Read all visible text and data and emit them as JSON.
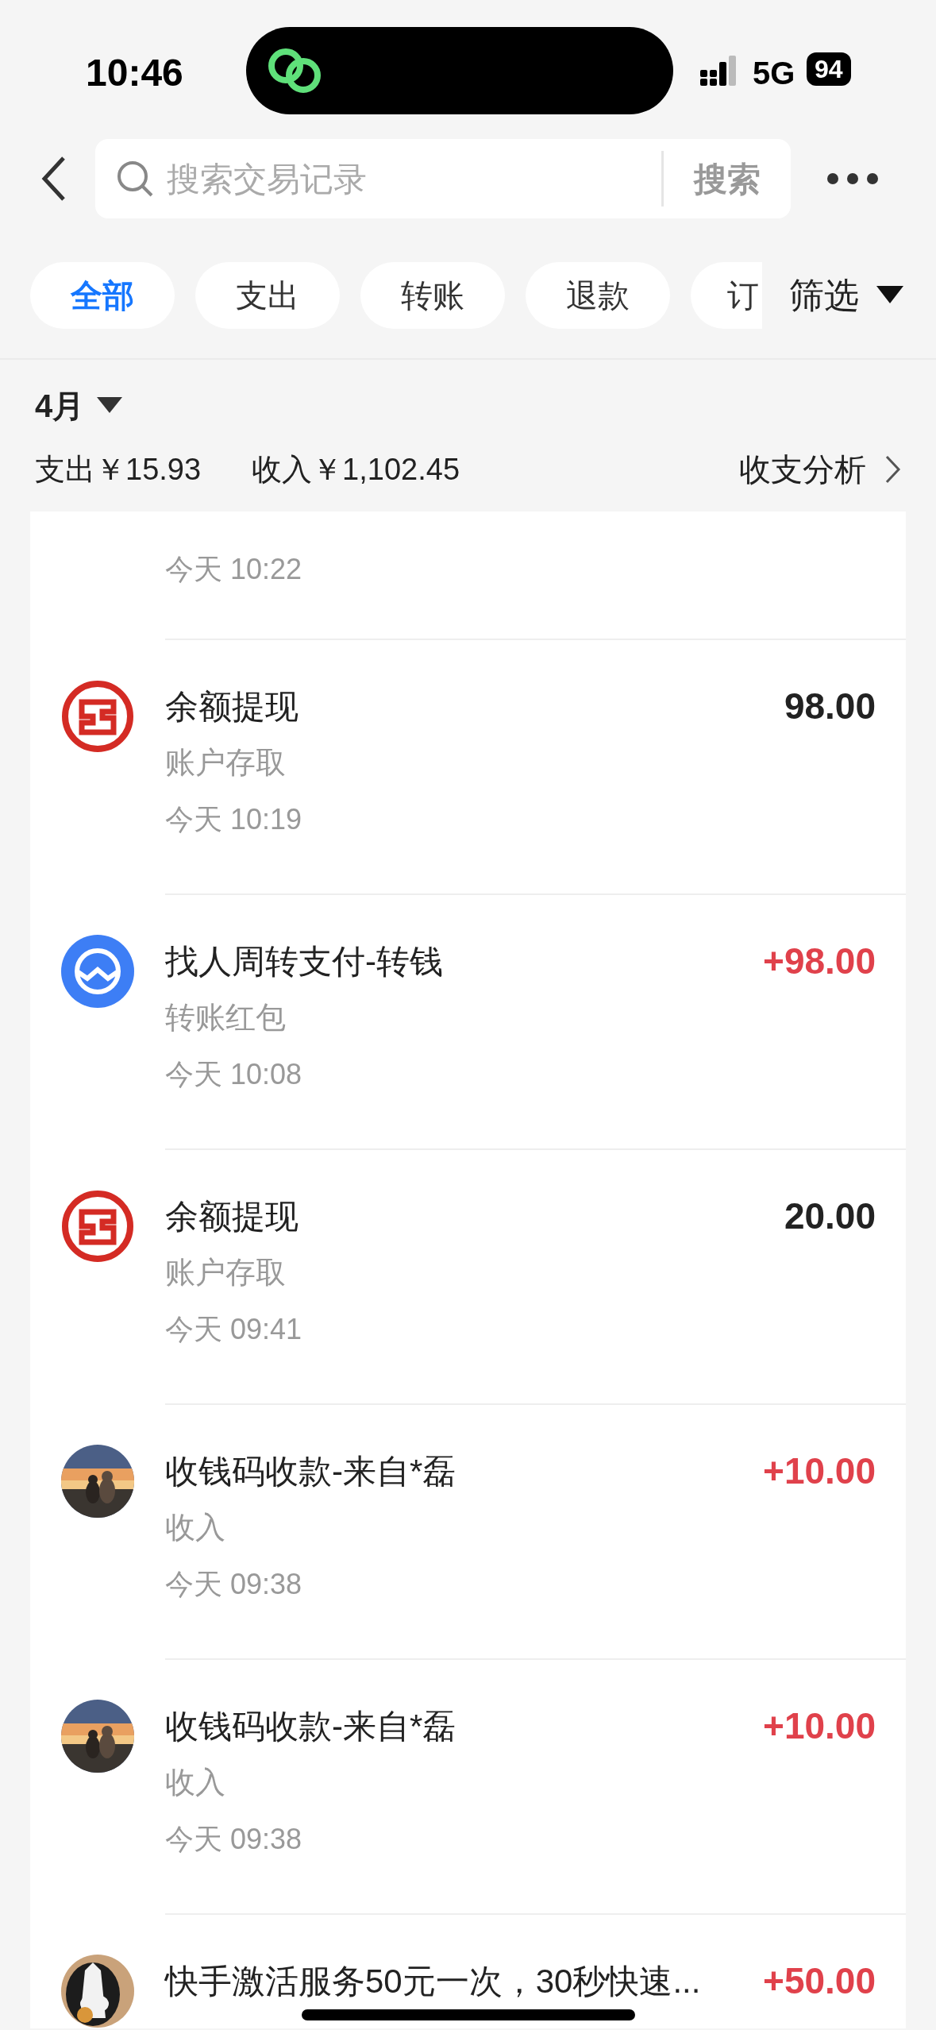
{
  "status_bar": {
    "time": "10:46",
    "network": "5G",
    "battery": "94"
  },
  "search": {
    "placeholder": "搜索交易记录",
    "button": "搜索"
  },
  "tabs": [
    {
      "label": "全部",
      "selected": true
    },
    {
      "label": "支出",
      "selected": false
    },
    {
      "label": "转账",
      "selected": false
    },
    {
      "label": "退款",
      "selected": false
    },
    {
      "label": "订",
      "selected": false
    }
  ],
  "filter": "筛选",
  "summary": {
    "month": "4月",
    "expense": "支出￥15.93",
    "income": "收入￥1,102.45",
    "analysis": "收支分析"
  },
  "partial_row_time": "今天 10:22",
  "transactions": [
    {
      "kind": "bank",
      "title": "余额提现",
      "amount": "98.00",
      "income": false,
      "category": "账户存取",
      "time": "今天 10:19"
    },
    {
      "kind": "transfer",
      "title": "找人周转支付-转钱",
      "amount": "+98.00",
      "income": true,
      "category": "转账红包",
      "time": "今天 10:08"
    },
    {
      "kind": "bank",
      "title": "余额提现",
      "amount": "20.00",
      "income": false,
      "category": "账户存取",
      "time": "今天 09:41"
    },
    {
      "title": "收钱码收款-来自*磊",
      "amount": "+10.00",
      "income": true,
      "category": "收入",
      "time": "今天 09:38"
    },
    {
      "title": "收钱码收款-来自*磊",
      "amount": "+10.00",
      "income": true,
      "category": "收入",
      "time": "今天 09:38"
    },
    {
      "kind": "dog",
      "title": "快手激活服务50元一次，30秒快速...",
      "amount": "+50.00",
      "income": true
    }
  ]
}
